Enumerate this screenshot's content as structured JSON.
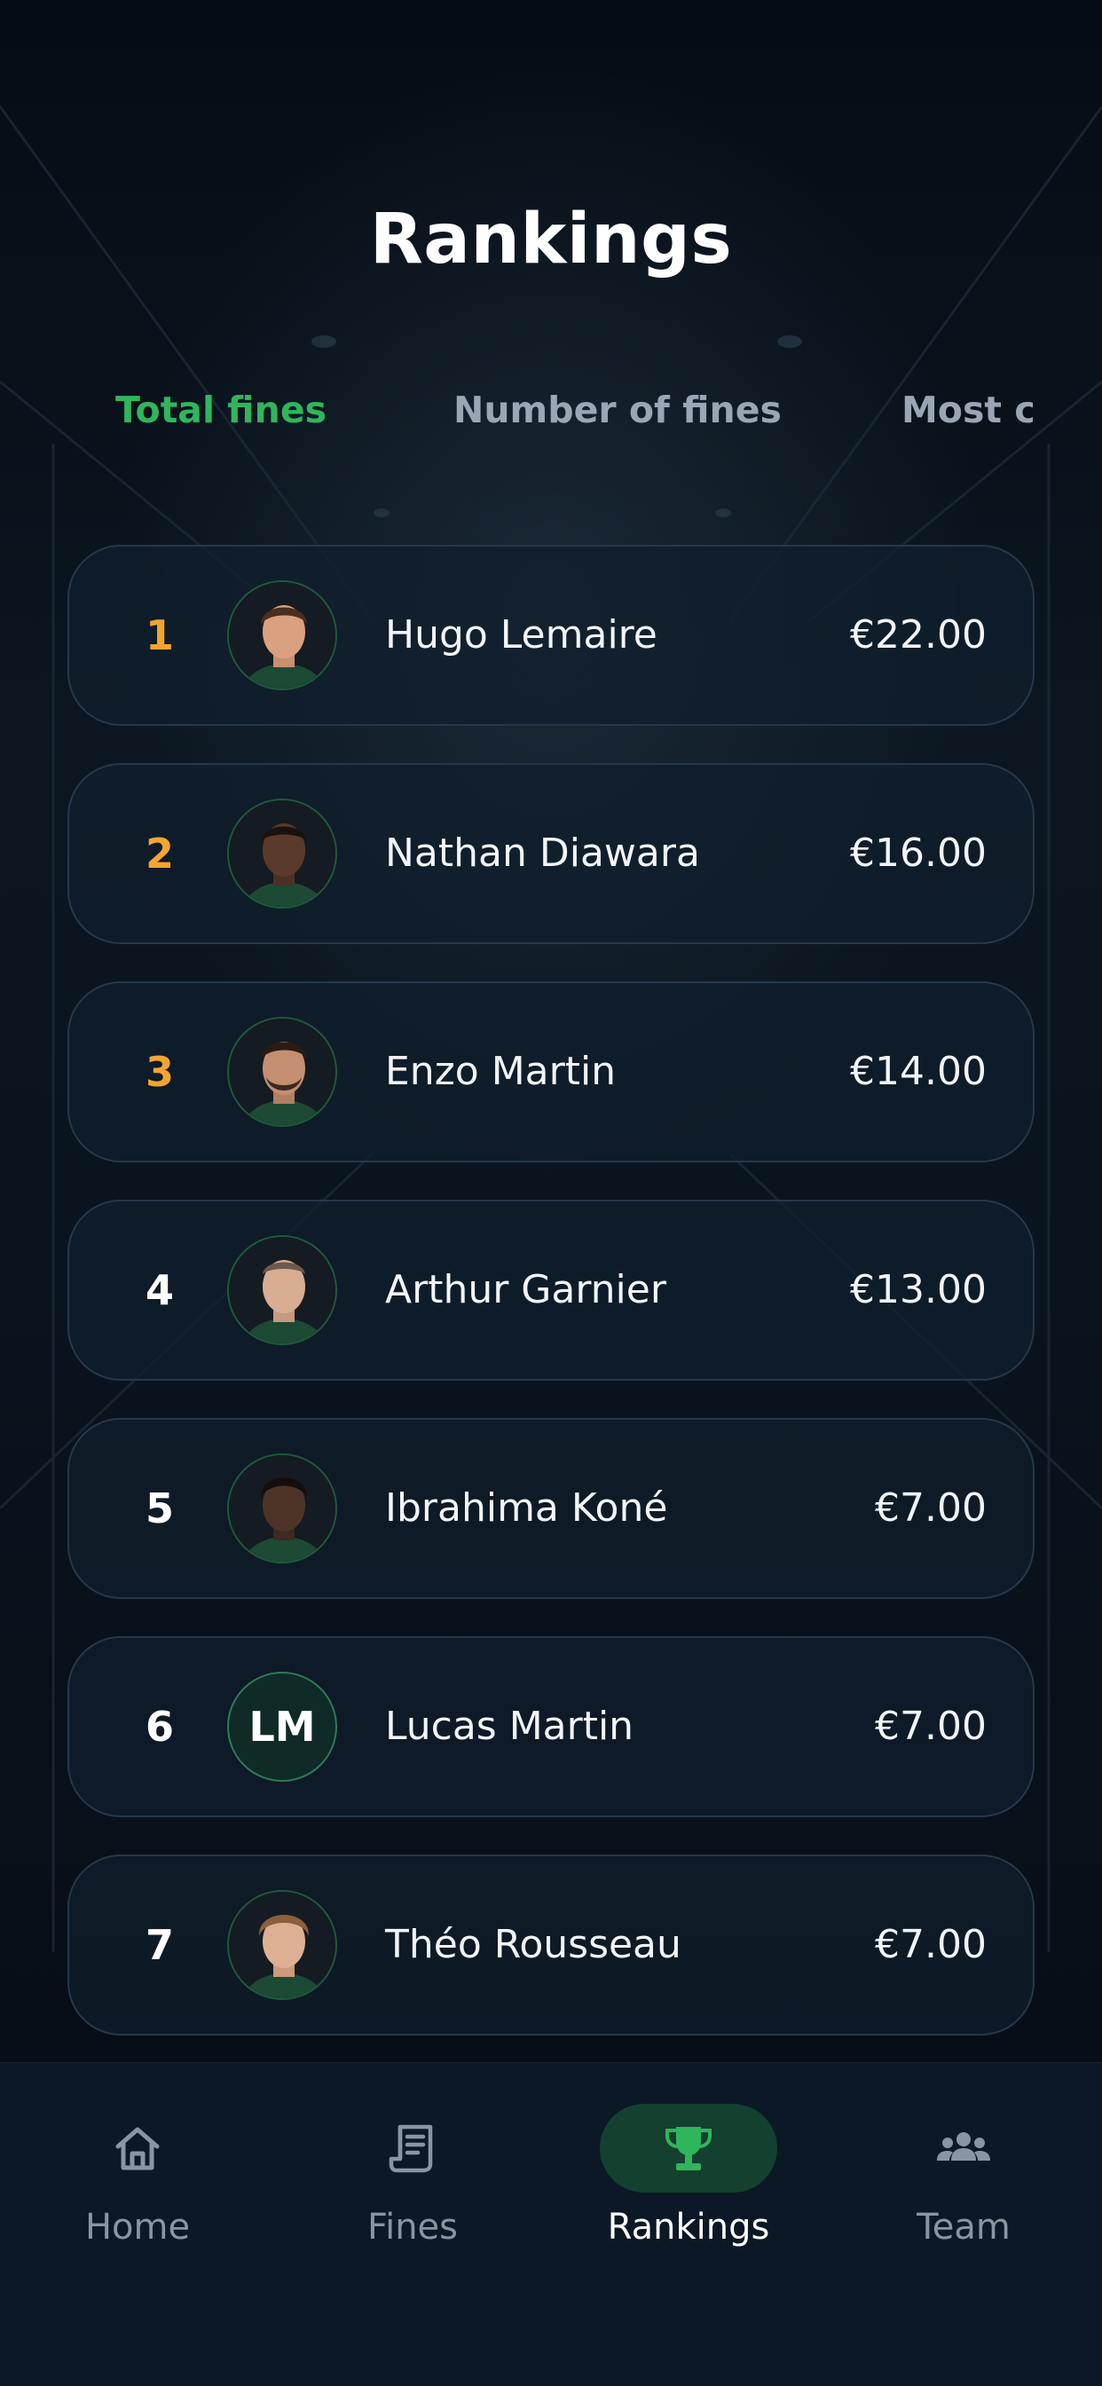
{
  "header": {
    "title": "Rankings"
  },
  "tabs": [
    {
      "label": "Total fines",
      "active": true
    },
    {
      "label": "Number of fines",
      "active": false
    },
    {
      "label": "Most c",
      "active": false
    }
  ],
  "rankings": [
    {
      "rank": "1",
      "name": "Hugo Lemaire",
      "amount": "€22.00",
      "avatar": "photo"
    },
    {
      "rank": "2",
      "name": "Nathan Diawara",
      "amount": "€16.00",
      "avatar": "photo"
    },
    {
      "rank": "3",
      "name": "Enzo Martin",
      "amount": "€14.00",
      "avatar": "photo"
    },
    {
      "rank": "4",
      "name": "Arthur Garnier",
      "amount": "€13.00",
      "avatar": "photo"
    },
    {
      "rank": "5",
      "name": "Ibrahima Koné",
      "amount": "€7.00",
      "avatar": "photo"
    },
    {
      "rank": "6",
      "name": "Lucas Martin",
      "amount": "€7.00",
      "avatar": "initials",
      "initials": "LM"
    },
    {
      "rank": "7",
      "name": "Théo Rousseau",
      "amount": "€7.00",
      "avatar": "photo"
    }
  ],
  "nav": [
    {
      "label": "Home",
      "icon": "home-icon",
      "active": false
    },
    {
      "label": "Fines",
      "icon": "receipt-icon",
      "active": false
    },
    {
      "label": "Rankings",
      "icon": "trophy-icon",
      "active": true
    },
    {
      "label": "Team",
      "icon": "team-icon",
      "active": false
    }
  ],
  "colors": {
    "accent": "#2fb65c",
    "podium": "#f3a530",
    "background": "#070e17",
    "card": "#101e2c"
  }
}
